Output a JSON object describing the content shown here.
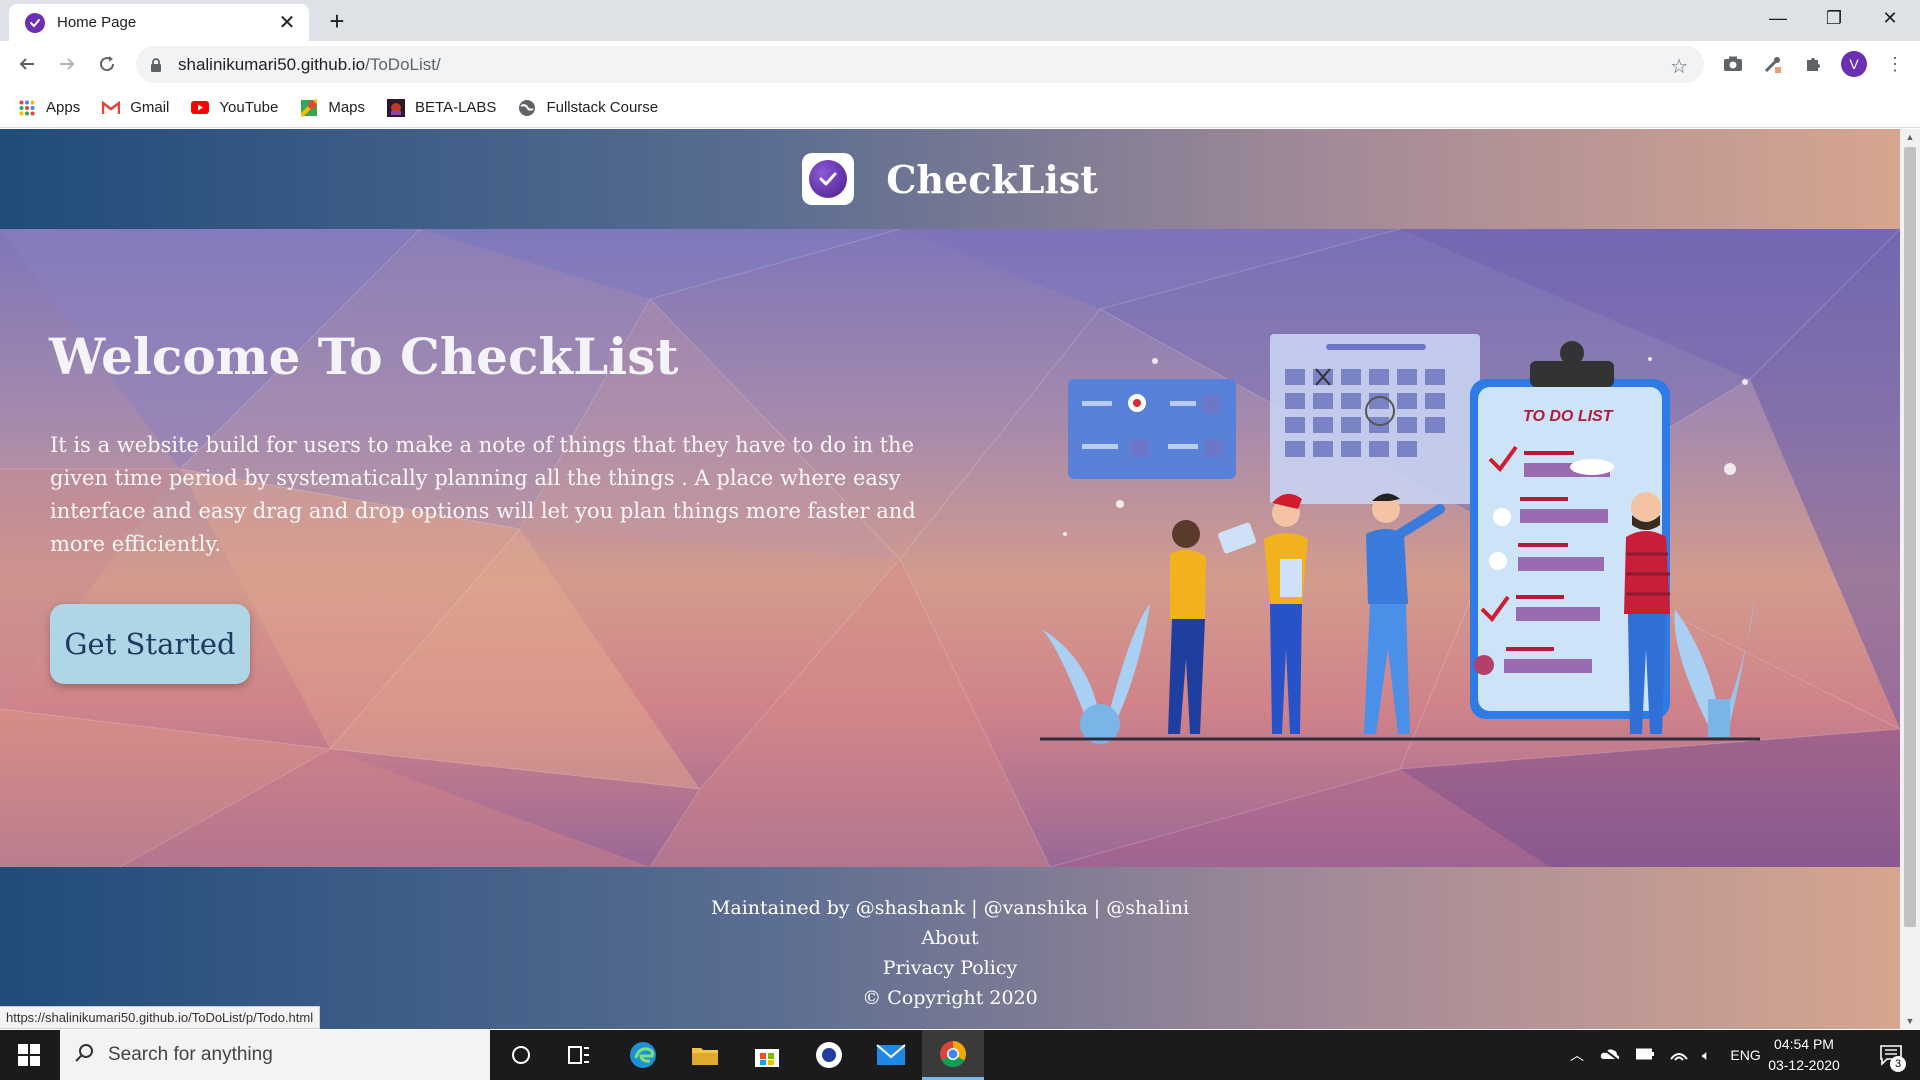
{
  "browser": {
    "tab_title": "Home Page",
    "url_host": "shalinikumari50.github.io",
    "url_path": "/ToDoList/",
    "profile_initial": "V",
    "bookmarks": [
      "Apps",
      "Gmail",
      "YouTube",
      "Maps",
      "BETA-LABS",
      "Fullstack Course"
    ],
    "status_url": "https://shalinikumari50.github.io/ToDoList/p/Todo.html"
  },
  "site": {
    "title": "CheckList",
    "hero_heading": "Welcome To CheckList",
    "hero_text": "It is a website build for users to make a note of things that they have to do in the given time period by systematically planning all the things . A place where easy interface and easy drag and drop options will let you plan things more faster and more efficiently.",
    "cta_label": "Get Started",
    "illustration_label": "TO DO LIST"
  },
  "footer": {
    "maintained": "Maintained by @shashank | @vanshika | @shalini",
    "about": "About",
    "privacy": "Privacy Policy",
    "copyright": "© Copyright 2020"
  },
  "taskbar": {
    "search_placeholder": "Search for anything",
    "language": "ENG",
    "time": "04:54 PM",
    "date": "03-12-2020",
    "notification_count": "3"
  },
  "colors": {
    "brand_purple": "#6a2fb3",
    "header_gradient_start": "#1f4c7a",
    "header_gradient_end": "#d7a58f",
    "cta_background": "#aed6e7"
  }
}
